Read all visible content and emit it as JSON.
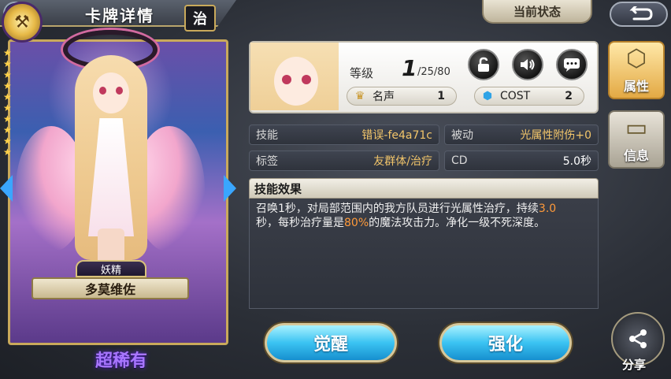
{
  "header": {
    "title": "卡牌详情",
    "status_button": "当前状态",
    "back_icon": "return-arrow-icon"
  },
  "card": {
    "type_badge": "治",
    "race": "妖精",
    "name": "多莫维佐",
    "rarity": "超稀有",
    "emblem_icon": "hammer-emblem-icon",
    "rarity_color": "#a876ff"
  },
  "info": {
    "level_label": "等级",
    "level_value": "1",
    "level_max": "/25/80",
    "fame_label": "名声",
    "fame_value": "1",
    "cost_label": "COST",
    "cost_value": "2",
    "buttons": [
      "lock-icon",
      "sound-icon",
      "chat-icon"
    ]
  },
  "rows": {
    "skill_label": "技能",
    "skill_value": "错误-fe4a71c",
    "passive_label": "被动",
    "passive_value": "光属性附伤+0",
    "tag_label": "标签",
    "tag_value": "友群体/治疗",
    "cd_label": "CD",
    "cd_value": "5.0秒"
  },
  "effect": {
    "title": "技能效果",
    "line1_a": "召唤1秒，对局部范围内的我方队员进行光属性治疗，持续",
    "line1_hl": "3.0",
    "line2_a": "秒，每秒治疗量是",
    "line2_hl": "80%",
    "line2_b": "的魔法攻击力。净化一级不死深度。"
  },
  "side_tabs": {
    "attributes": "属性",
    "info": "信息"
  },
  "actions": {
    "awaken": "觉醒",
    "enhance": "强化",
    "share": "分享"
  },
  "colors": {
    "accent_gold": "#c9a95b",
    "highlight_orange": "#ff9a3a",
    "value_gold": "#f2c56a",
    "button_blue": "#3bc3f2"
  }
}
